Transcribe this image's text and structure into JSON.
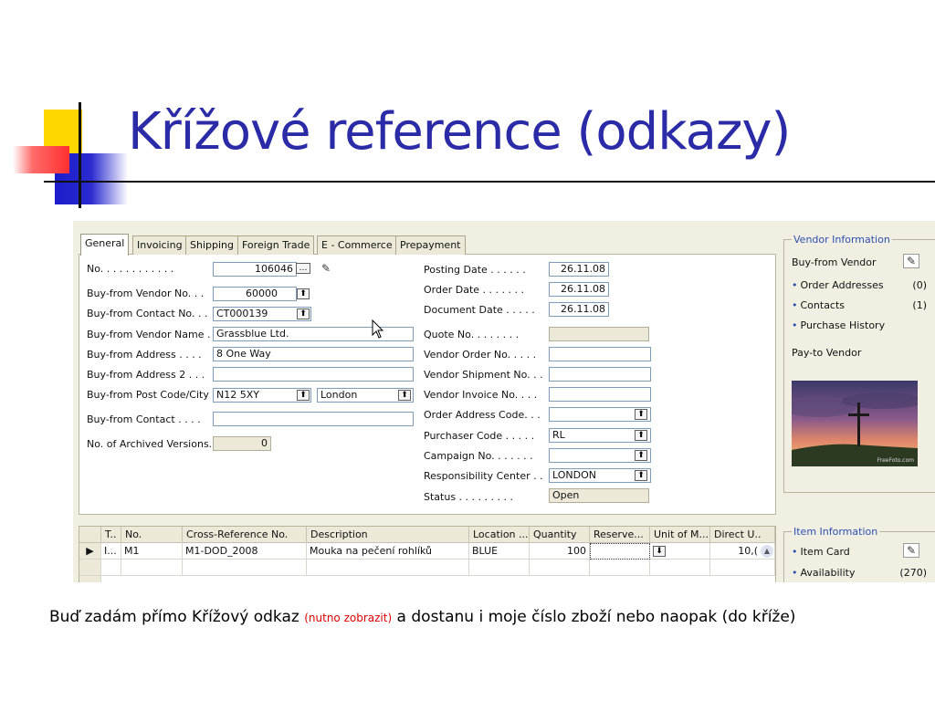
{
  "slide": {
    "title": "Křížové reference (odkazy)",
    "caption_part1": "Buď zadám přímo Křížový odkaz ",
    "caption_note": "(nutno zobrazit)",
    "caption_part2": " a dostanu i moje číslo zboží nebo naopak (do kříže)"
  },
  "tabs": [
    "General",
    "Invoicing",
    "Shipping",
    "Foreign Trade",
    "E - Commerce",
    "Prepayment"
  ],
  "left_fields": [
    {
      "label": "No. . . . . . . . . . . .",
      "value": "106046"
    },
    {
      "label": "Buy-from Vendor No. . .",
      "value": "60000"
    },
    {
      "label": "Buy-from Contact No. . .",
      "value": "CT000139"
    },
    {
      "label": "Buy-from Vendor Name .",
      "value": "Grassblue Ltd."
    },
    {
      "label": "Buy-from Address . . . .",
      "value": "8 One Way"
    },
    {
      "label": "Buy-from Address 2 . . .",
      "value": ""
    },
    {
      "label": "Buy-from Post Code/City",
      "value": "N12 5XY",
      "value2": "London"
    },
    {
      "label": "Buy-from Contact . . . .",
      "value": ""
    },
    {
      "label": "No. of Archived Versions.",
      "value": "0"
    }
  ],
  "right_fields": [
    {
      "label": "Posting Date . . . . . .",
      "value": "26.11.08"
    },
    {
      "label": "Order Date . . . . . . .",
      "value": "26.11.08"
    },
    {
      "label": "Document Date . . . . .",
      "value": "26.11.08"
    },
    {
      "label": "Quote No. . . . . . . .",
      "value": ""
    },
    {
      "label": "Vendor Order No. . . . .",
      "value": ""
    },
    {
      "label": "Vendor Shipment No. . .",
      "value": ""
    },
    {
      "label": "Vendor Invoice No. . . .",
      "value": ""
    },
    {
      "label": "Order Address Code. . .",
      "value": ""
    },
    {
      "label": "Purchaser Code . . . . .",
      "value": "RL"
    },
    {
      "label": "Campaign No. . . . . . .",
      "value": ""
    },
    {
      "label": "Responsibility Center . .",
      "value": "LONDON"
    },
    {
      "label": "Status . . . . . . . . .",
      "value": "Open"
    }
  ],
  "grid": {
    "headers": [
      "T..",
      "No.",
      "Cross-Reference No.",
      "Description",
      "Location ...",
      "Quantity",
      "Reserve...",
      "Unit of M...",
      "Direct U.."
    ],
    "row": [
      "I...",
      "M1",
      "M1-DOD_2008",
      "Mouka na pečení  rohlíků",
      "BLUE",
      "100",
      "",
      "",
      "10,("
    ]
  },
  "vendor_info": {
    "title": "Vendor Information",
    "buy_from": "Buy-from Vendor",
    "items": [
      {
        "label": "Order Addresses",
        "count": "(0)"
      },
      {
        "label": "Contacts",
        "count": "(1)"
      },
      {
        "label": "Purchase History",
        "count": ""
      }
    ],
    "pay_to": "Pay-to Vendor",
    "image_watermark": "FreeFoto.com"
  },
  "item_info": {
    "title": "Item Information",
    "items": [
      {
        "label": "Item Card",
        "count": ""
      },
      {
        "label": "Availability",
        "count": "(270)"
      }
    ]
  },
  "icons": {
    "lookup": "arrow-up-icon",
    "drilldown": "arrow-down-icon",
    "assist": "ellipsis-icon",
    "edit": "pencil-icon"
  }
}
